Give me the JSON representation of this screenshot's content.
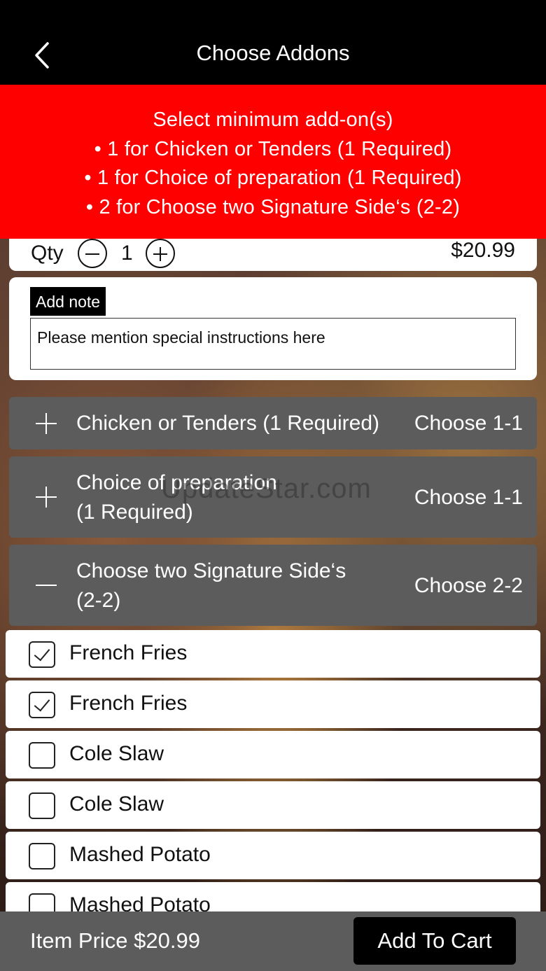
{
  "header": {
    "title": "Choose Addons"
  },
  "banner": {
    "lines": [
      "Select minimum add-on(s)",
      "• 1 for Chicken or Tenders (1 Required)",
      "• 1 for Choice of preparation (1 Required)",
      "• 2 for Choose two Signature Side‘s (2-2)"
    ]
  },
  "qty": {
    "label": "Qty",
    "value": "1",
    "price": "$20.99"
  },
  "note": {
    "label": "Add note",
    "placeholder": "Please mention special instructions here"
  },
  "groups": [
    {
      "title": "Chicken or Tenders (1 Required)",
      "choose": "Choose 1-1",
      "expanded": false
    },
    {
      "title_line1": "Choice of preparation",
      "title_line2": "(1 Required)",
      "choose": "Choose 1-1",
      "expanded": false
    },
    {
      "title_line1": "Choose two Signature Side‘s",
      "title_line2": "(2-2)",
      "choose": "Choose 2-2",
      "expanded": true
    }
  ],
  "options": [
    {
      "label": "French Fries",
      "checked": true
    },
    {
      "label": "French Fries",
      "checked": true
    },
    {
      "label": "Cole Slaw",
      "checked": false
    },
    {
      "label": "Cole Slaw",
      "checked": false
    },
    {
      "label": "Mashed Potato",
      "checked": false
    },
    {
      "label": "Mashed Potato",
      "checked": false
    }
  ],
  "footer": {
    "item_price": "Item Price  $20.99",
    "add_to_cart": "Add To Cart"
  },
  "watermark": "UpdateStar.com",
  "colors": {
    "banner": "#ff0000",
    "group_bg": "#5c5c5c",
    "topbar": "#000000"
  }
}
